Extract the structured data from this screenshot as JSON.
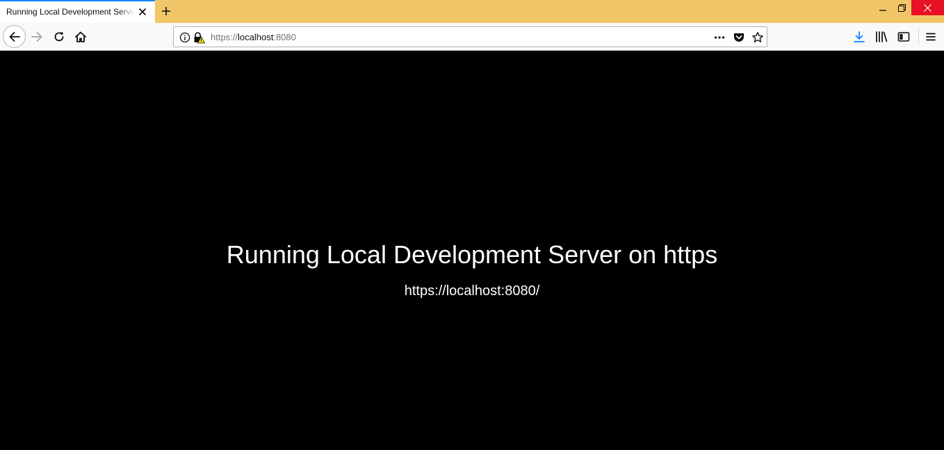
{
  "tab": {
    "title": "Running Local Development Server on https",
    "close_icon": "close-icon"
  },
  "toolbar": {
    "new_tab_icon": "plus-icon",
    "back_icon": "arrow-left-icon",
    "forward_icon": "arrow-right-icon",
    "reload_icon": "reload-icon",
    "home_icon": "home-icon"
  },
  "urlbar": {
    "scheme": "https://",
    "host": "localhost",
    "port": ":8080",
    "info_icon": "info-icon",
    "lock_warning_icon": "lock-warning-icon",
    "page_actions_icon": "ellipsis-icon",
    "pocket_icon": "pocket-icon",
    "bookmark_icon": "star-icon"
  },
  "right_toolbar": {
    "download_icon": "download-icon",
    "library_icon": "library-icon",
    "sidebar_icon": "sidebar-icon",
    "menu_icon": "hamburger-menu-icon"
  },
  "page": {
    "heading": "Running Local Development Server on https",
    "url": "https://localhost:8080/"
  },
  "colors": {
    "tabstrip": "#f0c668",
    "active_tab_accent": "#0a84ff",
    "page_background": "#000000",
    "page_text": "#ffffff",
    "download_accent": "#0a84ff",
    "close_button": "#e81123"
  }
}
